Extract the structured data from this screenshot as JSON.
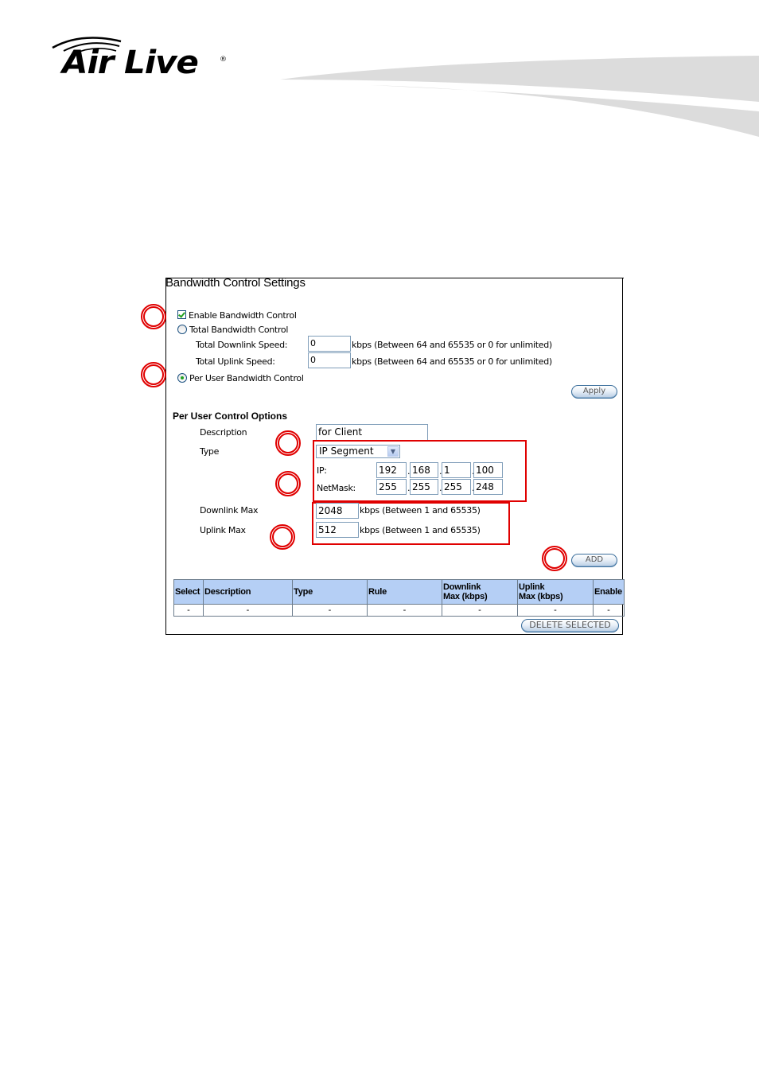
{
  "header": {
    "logo_text": "Air Live",
    "logo_registered": "®"
  },
  "panel": {
    "title": "Bandwidth Control Settings",
    "enable_bandwidth_control": {
      "label": "Enable Bandwidth Control",
      "checked": true
    },
    "total_bandwidth_control": {
      "label": "Total Bandwidth Control",
      "selected": false
    },
    "total_downlink": {
      "label": "Total Downlink Speed:",
      "value": "0",
      "hint": "kbps (Between 64 and 65535 or 0 for unlimited)"
    },
    "total_uplink": {
      "label": "Total Uplink Speed:",
      "value": "0",
      "hint": "kbps (Between 64 and 65535 or 0 for unlimited)"
    },
    "per_user_bandwidth_control": {
      "label": "Per User Bandwidth Control",
      "selected": true
    },
    "apply_label": "Apply"
  },
  "per_user": {
    "section_title": "Per User Control Options",
    "description": {
      "label": "Description",
      "value": "for Client"
    },
    "type": {
      "label": "Type",
      "selected": "IP Segment"
    },
    "ip": {
      "label": "IP:",
      "octets": [
        "192",
        "168",
        "1",
        "100"
      ]
    },
    "netmask": {
      "label": "NetMask:",
      "octets": [
        "255",
        "255",
        "255",
        "248"
      ]
    },
    "ip_separator": ".",
    "downlink_max": {
      "label": "Downlink Max",
      "value": "2048",
      "hint": "kbps (Between 1 and 65535)"
    },
    "uplink_max": {
      "label": "Uplink Max",
      "value": "512",
      "hint": "kbps (Between 1 and 65535)"
    },
    "add_label": "ADD"
  },
  "rules_table": {
    "columns": [
      {
        "line1": "Select",
        "line2": ""
      },
      {
        "line1": "Description",
        "line2": ""
      },
      {
        "line1": "Type",
        "line2": ""
      },
      {
        "line1": "Rule",
        "line2": ""
      },
      {
        "line1": "Downlink",
        "line2": "Max (kbps)"
      },
      {
        "line1": "Uplink",
        "line2": "Max (kbps)"
      },
      {
        "line1": "Enable",
        "line2": ""
      }
    ],
    "rows": [
      [
        "-",
        "-",
        "-",
        "-",
        "-",
        "-",
        "-"
      ]
    ],
    "delete_selected_label": "DELETE SELECTED"
  },
  "colors": {
    "annotation_red": "#e00000",
    "table_header_bg": "#b5cff5",
    "swoosh_gray": "#dcdcdc"
  }
}
